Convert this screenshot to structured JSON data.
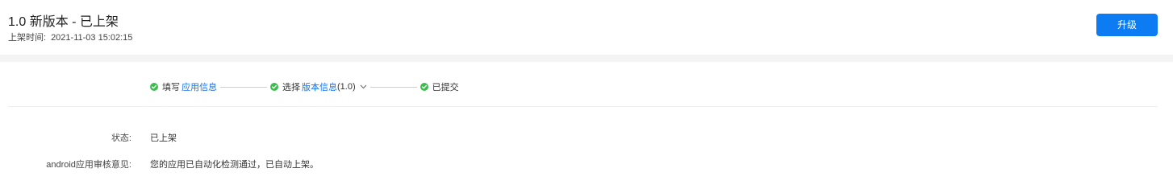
{
  "header": {
    "title": "1.0 新版本 - 已上架",
    "time_label": "上架时间:",
    "time_value": "2021-11-03 15:02:15",
    "upgrade_label": "升级"
  },
  "steps": [
    {
      "prefix": "填写",
      "link": "应用信息",
      "suffix": ""
    },
    {
      "prefix": "选择",
      "link": "版本信息",
      "suffix": "(1.0)"
    },
    {
      "prefix": "已提交",
      "link": "",
      "suffix": ""
    }
  ],
  "details": [
    {
      "label": "状态:",
      "value": "已上架"
    },
    {
      "label": "android应用审核意见:",
      "value": "您的应用已自动化检测通过，已自动上架。"
    }
  ],
  "colors": {
    "primary": "#0d7cf2",
    "link": "#1a73e8",
    "success": "#3dbd4f"
  },
  "icons": {
    "step_status": "check-circle-icon",
    "version_dropdown": "chevron-down-icon"
  }
}
